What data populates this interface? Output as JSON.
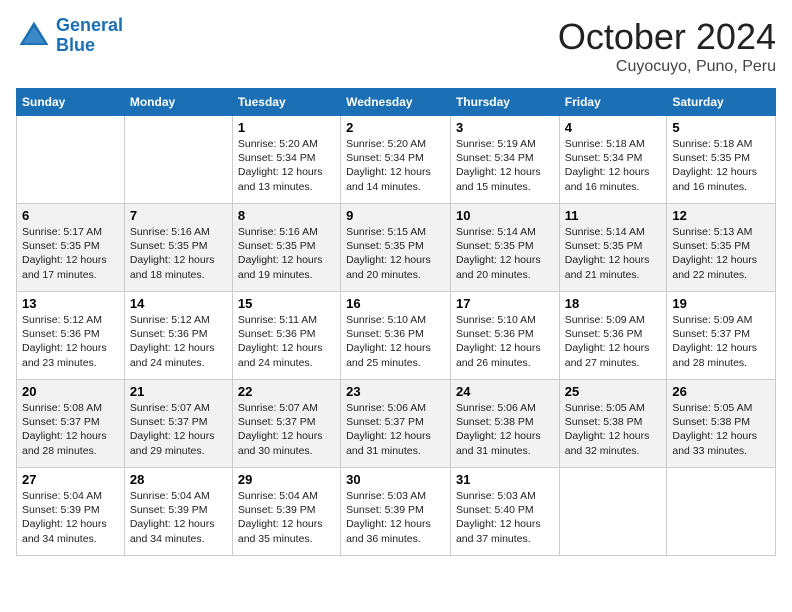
{
  "header": {
    "logo_general": "General",
    "logo_blue": "Blue",
    "month": "October 2024",
    "location": "Cuyocuyo, Puno, Peru"
  },
  "days_of_week": [
    "Sunday",
    "Monday",
    "Tuesday",
    "Wednesday",
    "Thursday",
    "Friday",
    "Saturday"
  ],
  "weeks": [
    [
      {
        "day": "",
        "info": ""
      },
      {
        "day": "",
        "info": ""
      },
      {
        "day": "1",
        "info": "Sunrise: 5:20 AM\nSunset: 5:34 PM\nDaylight: 12 hours and 13 minutes."
      },
      {
        "day": "2",
        "info": "Sunrise: 5:20 AM\nSunset: 5:34 PM\nDaylight: 12 hours and 14 minutes."
      },
      {
        "day": "3",
        "info": "Sunrise: 5:19 AM\nSunset: 5:34 PM\nDaylight: 12 hours and 15 minutes."
      },
      {
        "day": "4",
        "info": "Sunrise: 5:18 AM\nSunset: 5:34 PM\nDaylight: 12 hours and 16 minutes."
      },
      {
        "day": "5",
        "info": "Sunrise: 5:18 AM\nSunset: 5:35 PM\nDaylight: 12 hours and 16 minutes."
      }
    ],
    [
      {
        "day": "6",
        "info": "Sunrise: 5:17 AM\nSunset: 5:35 PM\nDaylight: 12 hours and 17 minutes."
      },
      {
        "day": "7",
        "info": "Sunrise: 5:16 AM\nSunset: 5:35 PM\nDaylight: 12 hours and 18 minutes."
      },
      {
        "day": "8",
        "info": "Sunrise: 5:16 AM\nSunset: 5:35 PM\nDaylight: 12 hours and 19 minutes."
      },
      {
        "day": "9",
        "info": "Sunrise: 5:15 AM\nSunset: 5:35 PM\nDaylight: 12 hours and 20 minutes."
      },
      {
        "day": "10",
        "info": "Sunrise: 5:14 AM\nSunset: 5:35 PM\nDaylight: 12 hours and 20 minutes."
      },
      {
        "day": "11",
        "info": "Sunrise: 5:14 AM\nSunset: 5:35 PM\nDaylight: 12 hours and 21 minutes."
      },
      {
        "day": "12",
        "info": "Sunrise: 5:13 AM\nSunset: 5:35 PM\nDaylight: 12 hours and 22 minutes."
      }
    ],
    [
      {
        "day": "13",
        "info": "Sunrise: 5:12 AM\nSunset: 5:36 PM\nDaylight: 12 hours and 23 minutes."
      },
      {
        "day": "14",
        "info": "Sunrise: 5:12 AM\nSunset: 5:36 PM\nDaylight: 12 hours and 24 minutes."
      },
      {
        "day": "15",
        "info": "Sunrise: 5:11 AM\nSunset: 5:36 PM\nDaylight: 12 hours and 24 minutes."
      },
      {
        "day": "16",
        "info": "Sunrise: 5:10 AM\nSunset: 5:36 PM\nDaylight: 12 hours and 25 minutes."
      },
      {
        "day": "17",
        "info": "Sunrise: 5:10 AM\nSunset: 5:36 PM\nDaylight: 12 hours and 26 minutes."
      },
      {
        "day": "18",
        "info": "Sunrise: 5:09 AM\nSunset: 5:36 PM\nDaylight: 12 hours and 27 minutes."
      },
      {
        "day": "19",
        "info": "Sunrise: 5:09 AM\nSunset: 5:37 PM\nDaylight: 12 hours and 28 minutes."
      }
    ],
    [
      {
        "day": "20",
        "info": "Sunrise: 5:08 AM\nSunset: 5:37 PM\nDaylight: 12 hours and 28 minutes."
      },
      {
        "day": "21",
        "info": "Sunrise: 5:07 AM\nSunset: 5:37 PM\nDaylight: 12 hours and 29 minutes."
      },
      {
        "day": "22",
        "info": "Sunrise: 5:07 AM\nSunset: 5:37 PM\nDaylight: 12 hours and 30 minutes."
      },
      {
        "day": "23",
        "info": "Sunrise: 5:06 AM\nSunset: 5:37 PM\nDaylight: 12 hours and 31 minutes."
      },
      {
        "day": "24",
        "info": "Sunrise: 5:06 AM\nSunset: 5:38 PM\nDaylight: 12 hours and 31 minutes."
      },
      {
        "day": "25",
        "info": "Sunrise: 5:05 AM\nSunset: 5:38 PM\nDaylight: 12 hours and 32 minutes."
      },
      {
        "day": "26",
        "info": "Sunrise: 5:05 AM\nSunset: 5:38 PM\nDaylight: 12 hours and 33 minutes."
      }
    ],
    [
      {
        "day": "27",
        "info": "Sunrise: 5:04 AM\nSunset: 5:39 PM\nDaylight: 12 hours and 34 minutes."
      },
      {
        "day": "28",
        "info": "Sunrise: 5:04 AM\nSunset: 5:39 PM\nDaylight: 12 hours and 34 minutes."
      },
      {
        "day": "29",
        "info": "Sunrise: 5:04 AM\nSunset: 5:39 PM\nDaylight: 12 hours and 35 minutes."
      },
      {
        "day": "30",
        "info": "Sunrise: 5:03 AM\nSunset: 5:39 PM\nDaylight: 12 hours and 36 minutes."
      },
      {
        "day": "31",
        "info": "Sunrise: 5:03 AM\nSunset: 5:40 PM\nDaylight: 12 hours and 37 minutes."
      },
      {
        "day": "",
        "info": ""
      },
      {
        "day": "",
        "info": ""
      }
    ]
  ]
}
